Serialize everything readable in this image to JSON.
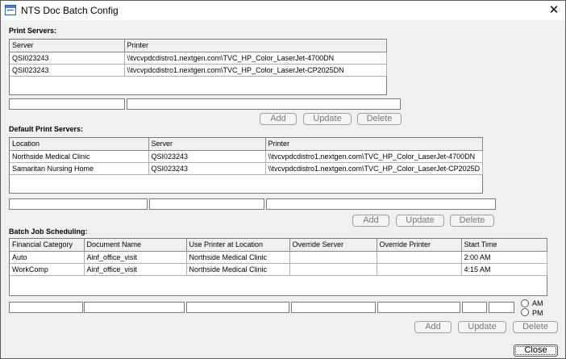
{
  "window": {
    "title": "NTS Doc Batch Config",
    "close_glyph": "✕"
  },
  "print_servers": {
    "label": "Print Servers:",
    "columns": [
      "Server",
      "Printer"
    ],
    "rows": [
      [
        "QSI023243",
        "\\\\tvcvpdcdistro1.nextgen.com\\TVC_HP_Color_LaserJet-4700DN"
      ],
      [
        "QSI023243",
        "\\\\tvcvpdcdistro1.nextgen.com\\TVC_HP_Color_LaserJet-CP2025DN"
      ]
    ],
    "buttons": {
      "add": "Add",
      "update": "Update",
      "delete": "Delete"
    }
  },
  "default_print_servers": {
    "label": "Default Print Servers:",
    "columns": [
      "Location",
      "Server",
      "Printer"
    ],
    "rows": [
      [
        "Northside Medical Clinic",
        "QSI023243",
        "\\\\tvcvpdcdistro1.nextgen.com\\TVC_HP_Color_LaserJet-4700DN"
      ],
      [
        "Samaritan Nursing Home",
        "QSI023243",
        "\\\\tvcvpdcdistro1.nextgen.com\\TVC_HP_Color_LaserJet-CP2025D"
      ]
    ],
    "buttons": {
      "add": "Add",
      "update": "Update",
      "delete": "Delete"
    }
  },
  "batch_job_scheduling": {
    "label": "Batch Job Scheduling:",
    "columns": [
      "Financial Category",
      "Document Name",
      "Use Printer at Location",
      "Override Server",
      "Override Printer",
      "Start Time"
    ],
    "rows": [
      [
        "Auto",
        "Ainf_office_visit",
        "Northside Medical Clinic",
        "",
        "",
        "2:00 AM"
      ],
      [
        "WorkComp",
        "Ainf_office_visit",
        "Northside Medical Clinic",
        "",
        "",
        "4:15 AM"
      ]
    ],
    "am_label": "AM",
    "pm_label": "PM",
    "buttons": {
      "add": "Add",
      "update": "Update",
      "delete": "Delete"
    }
  },
  "footer": {
    "close_label": "Close"
  }
}
